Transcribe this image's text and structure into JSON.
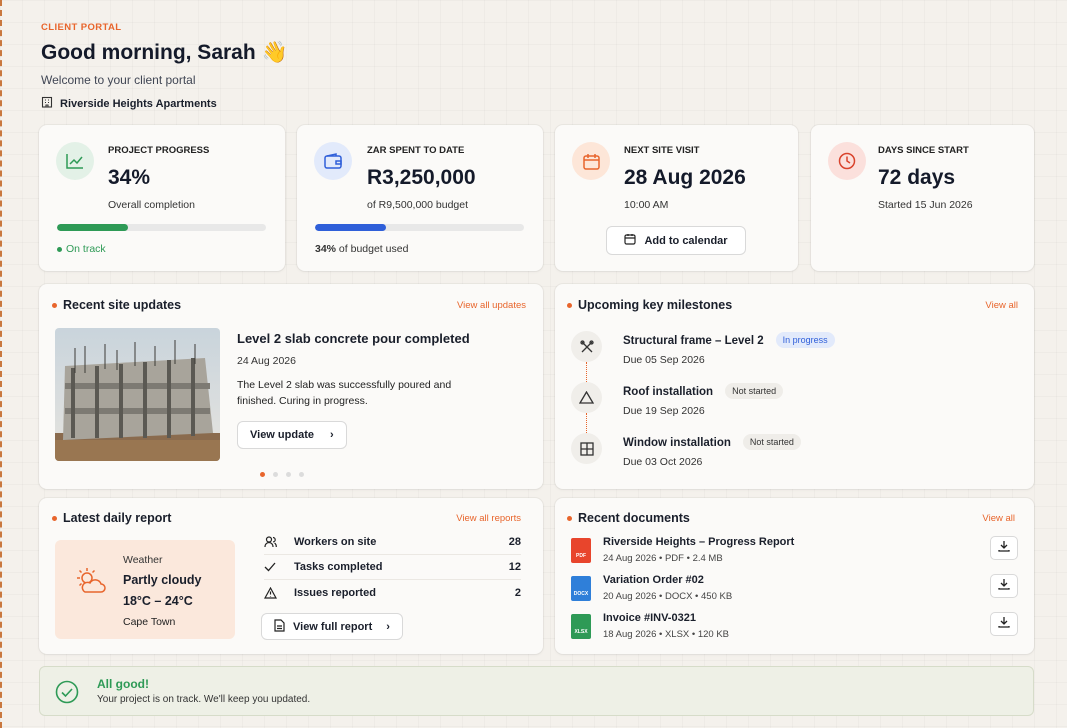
{
  "header": {
    "eyebrow": "CLIENT PORTAL",
    "greeting": "Good morning, Sarah 👋",
    "welcome": "Welcome to your client portal",
    "project_name": "Riverside Heights Apartments"
  },
  "stats": {
    "progress": {
      "label": "PROJECT PROGRESS",
      "value": "34%",
      "sub": "Overall completion",
      "fraction": 0.34,
      "status": "On track",
      "color": "#2e9a56"
    },
    "spent": {
      "label": "ZAR SPENT TO DATE",
      "value": "R3,250,000",
      "sub": "of R9,500,000 budget",
      "fraction": 0.34,
      "pct": "34%",
      "pct_suffix": " of budget used",
      "color": "#2f5fd9"
    },
    "visit": {
      "label": "NEXT SITE VISIT",
      "value": "28 Aug 2026",
      "sub": "10:00 AM",
      "button": "Add to calendar"
    },
    "days": {
      "label": "DAYS SINCE START",
      "value": "72 days",
      "sub": "Started 15 Jun 2026"
    }
  },
  "updates": {
    "title": "Recent site updates",
    "link": "View all updates",
    "headline": "Level 2 slab concrete pour completed",
    "date": "24 Aug 2026",
    "body_line1": "The Level 2 slab was successfully poured and",
    "body_line2": "finished. Curing in progress.",
    "button": "View update",
    "active_slide": 1,
    "slides": 4
  },
  "milestones": {
    "title": "Upcoming key milestones",
    "link": "View all",
    "items": [
      {
        "title": "Structural frame – Level 2",
        "due": "Due 05 Sep 2026",
        "status": "In progress",
        "icon": "crane-icon"
      },
      {
        "title": "Roof installation",
        "due": "Due 19 Sep 2026",
        "status": "Not started",
        "icon": "roof-icon"
      },
      {
        "title": "Window installation",
        "due": "Due 03 Oct 2026",
        "status": "Not started",
        "icon": "window-icon"
      }
    ]
  },
  "daily": {
    "title": "Latest daily report",
    "link": "View all reports",
    "weather_label": "Weather",
    "weather_desc": "Partly cloudy",
    "weather_temp": "18°C – 24°C",
    "weather_city": "Cape Town",
    "rows": [
      {
        "label": "Workers on site",
        "value": "28",
        "icon": "workers-icon"
      },
      {
        "label": "Tasks completed",
        "value": "12",
        "icon": "check-icon"
      },
      {
        "label": "Issues reported",
        "value": "2",
        "icon": "warning-icon"
      }
    ],
    "button": "View full report"
  },
  "documents": {
    "title": "Recent documents",
    "link": "View all",
    "items": [
      {
        "title": "Riverside Heights – Progress Report",
        "meta": "24 Aug 2026  •  PDF  •  2.4 MB",
        "type": "PDF",
        "color": "#e8452c"
      },
      {
        "title": "Variation Order #02",
        "meta": "20 Aug 2026  •  DOCX  •  450 KB",
        "type": "DOCX",
        "color": "#2f7fd9"
      },
      {
        "title": "Invoice #INV-0321",
        "meta": "18 Aug 2026  •  XLSX  •  120 KB",
        "type": "XLSX",
        "color": "#2e9a56"
      }
    ]
  },
  "footer": {
    "title": "All good!",
    "message": "Your project is on track. We'll keep you updated."
  },
  "colors": {
    "accent": "#e8652c",
    "success": "#2e9a56",
    "primary": "#2f5fd9"
  }
}
